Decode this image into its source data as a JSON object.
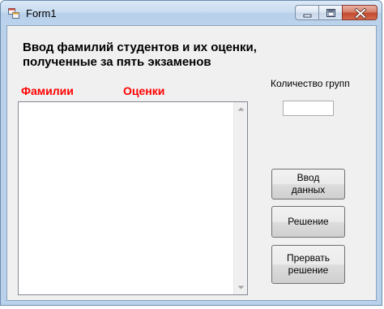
{
  "window": {
    "title": "Form1",
    "app_icon": "windows-form-icon",
    "caption_buttons": {
      "minimize_icon": "minimize-icon",
      "maximize_icon": "maximize-icon",
      "close_icon": "close-icon"
    },
    "close_color": "#c24a2f"
  },
  "form": {
    "heading": "Ввод фамилий студентов и их оценки, полученные за пять экзаменов",
    "columns": {
      "surnames": "Фамилии",
      "grades": "Оценки",
      "color": "#ff0000"
    },
    "groups": {
      "label": "Количество групп",
      "value": ""
    },
    "list_items": [],
    "buttons": {
      "input_data": "Ввод\nданных",
      "solve": "Решение",
      "abort": "Прервать\nрешение"
    }
  }
}
